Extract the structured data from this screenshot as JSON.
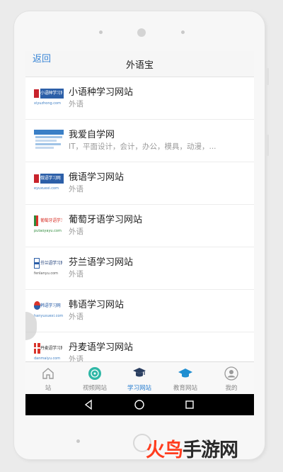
{
  "header": {
    "back_label": "返回",
    "title": "外语宝"
  },
  "list": {
    "items": [
      {
        "title": "小语种学习网站",
        "subtitle": "外语",
        "thumb_text": "小语种学习网",
        "thumb_url": "xiyuzhong.com"
      },
      {
        "title": "我爱自学网",
        "subtitle": "IT，平面设计，会计，办公，模具，动漫，...",
        "thumb_text": "",
        "thumb_url": ""
      },
      {
        "title": "俄语学习网站",
        "subtitle": "外语",
        "thumb_text": "俄语学习网",
        "thumb_url": "eyuxuexi.com"
      },
      {
        "title": "葡萄牙语学习网站",
        "subtitle": "外语",
        "thumb_text": "葡萄牙语学习网",
        "thumb_url": "putaoyayu.com"
      },
      {
        "title": "芬兰语学习网站",
        "subtitle": "外语",
        "thumb_text": "芬兰语学习网",
        "thumb_url": "fenlanyu.com"
      },
      {
        "title": "韩语学习网站",
        "subtitle": "外语",
        "thumb_text": "韩语学习网",
        "thumb_url": "hanyuxuexi.com"
      },
      {
        "title": "丹麦语学习网站",
        "subtitle": "外语",
        "thumb_text": "丹麦语学习网",
        "thumb_url": "danmaiyu.com"
      }
    ]
  },
  "tabs": [
    {
      "label": "站",
      "icon": "home-icon",
      "active": false
    },
    {
      "label": "视频网站",
      "icon": "film-reel-icon",
      "active": false
    },
    {
      "label": "学习网站",
      "icon": "graduation-cap-icon",
      "active": true
    },
    {
      "label": "教育网站",
      "icon": "mortarboard-icon",
      "active": false
    },
    {
      "label": "我的",
      "icon": "person-icon",
      "active": false
    }
  ],
  "system_nav": {
    "back": "back-triangle-icon",
    "home": "home-circle-icon",
    "recents": "recents-square-icon"
  },
  "watermark": {
    "accent": "火鸟",
    "rest": "手游网"
  },
  "colors": {
    "accent": "#2b7fd0",
    "back_link": "#3a86d6",
    "thumb_red": "#d9342b",
    "thumb_blue": "#2c5fa8",
    "watermark_red": "#ff3d1f",
    "teal_icon": "#2fb7a6"
  }
}
